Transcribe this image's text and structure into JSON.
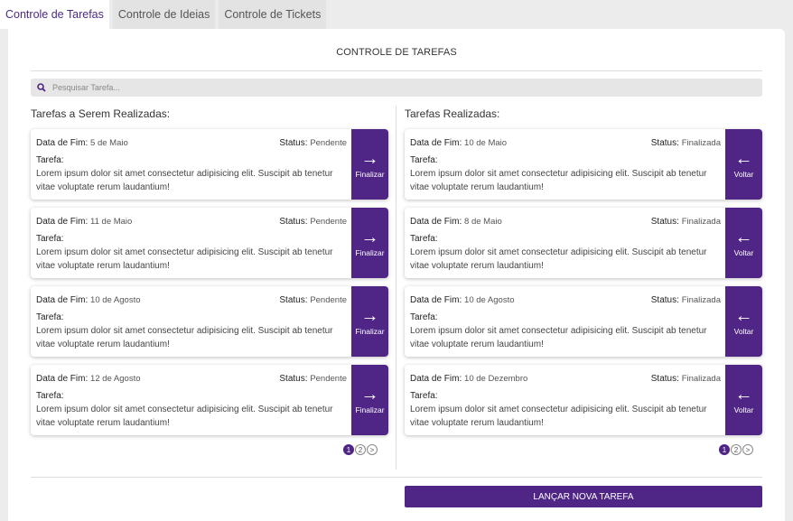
{
  "tabs": [
    {
      "label": "Controle de Tarefas",
      "active": true
    },
    {
      "label": "Controle de Ideias",
      "active": false
    },
    {
      "label": "Controle de Tickets",
      "active": false
    }
  ],
  "title": "CONTROLE DE TAREFAS",
  "search": {
    "placeholder": "Pesquisar Tarefa...",
    "icon": "search-icon"
  },
  "columns": {
    "pending": {
      "title": "Tarefas a Serem Realizadas:",
      "action_label": "Finalizar",
      "action_icon": "arrow-right-icon",
      "cards": [
        {
          "date_label": "Data de Fim:",
          "date": "5 de Maio",
          "status_label": "Status:",
          "status": "Pendente",
          "task_label": "Tarefa:",
          "description": "Lorem ipsum dolor sit amet consectetur adipisicing elit. Suscipit ab tenetur vitae voluptate rerum laudantium!"
        },
        {
          "date_label": "Data de Fim:",
          "date": "11 de Maio",
          "status_label": "Status:",
          "status": "Pendente",
          "task_label": "Tarefa:",
          "description": "Lorem ipsum dolor sit amet consectetur adipisicing elit. Suscipit ab tenetur vitae voluptate rerum laudantium!"
        },
        {
          "date_label": "Data de Fim:",
          "date": "10 de Agosto",
          "status_label": "Status:",
          "status": "Pendente",
          "task_label": "Tarefa:",
          "description": "Lorem ipsum dolor sit amet consectetur adipisicing elit. Suscipit ab tenetur vitae voluptate rerum laudantium!"
        },
        {
          "date_label": "Data de Fim:",
          "date": "12 de Agosto",
          "status_label": "Status:",
          "status": "Pendente",
          "task_label": "Tarefa:",
          "description": "Lorem ipsum dolor sit amet consectetur adipisicing elit. Suscipit ab tenetur vitae voluptate rerum laudantium!"
        }
      ],
      "pager": [
        "1",
        "2",
        ">"
      ]
    },
    "done": {
      "title": "Tarefas Realizadas:",
      "action_label": "Voltar",
      "action_icon": "arrow-left-icon",
      "cards": [
        {
          "date_label": "Data de Fim:",
          "date": "10 de Maio",
          "status_label": "Status:",
          "status": "Finalizada",
          "task_label": "Tarefa:",
          "description": "Lorem ipsum dolor sit amet consectetur adipisicing elit. Suscipit ab tenetur vitae voluptate rerum laudantium!"
        },
        {
          "date_label": "Data de Fim:",
          "date": "8 de Maio",
          "status_label": "Status:",
          "status": "Finalizada",
          "task_label": "Tarefa:",
          "description": "Lorem ipsum dolor sit amet consectetur adipisicing elit. Suscipit ab tenetur vitae voluptate rerum laudantium!"
        },
        {
          "date_label": "Data de Fim:",
          "date": "10 de Agosto",
          "status_label": "Status:",
          "status": "Finalizada",
          "task_label": "Tarefa:",
          "description": "Lorem ipsum dolor sit amet consectetur adipisicing elit. Suscipit ab tenetur vitae voluptate rerum laudantium!"
        },
        {
          "date_label": "Data de Fim:",
          "date": "10 de Dezembro",
          "status_label": "Status:",
          "status": "Finalizada",
          "task_label": "Tarefa:",
          "description": "Lorem ipsum dolor sit amet consectetur adipisicing elit. Suscipit ab tenetur vitae voluptate rerum laudantium!"
        }
      ],
      "pager": [
        "1",
        "2",
        ">"
      ]
    }
  },
  "launch_button": "LANÇAR NOVA TAREFA",
  "colors": {
    "accent": "#4f2586",
    "background": "#ececec"
  }
}
